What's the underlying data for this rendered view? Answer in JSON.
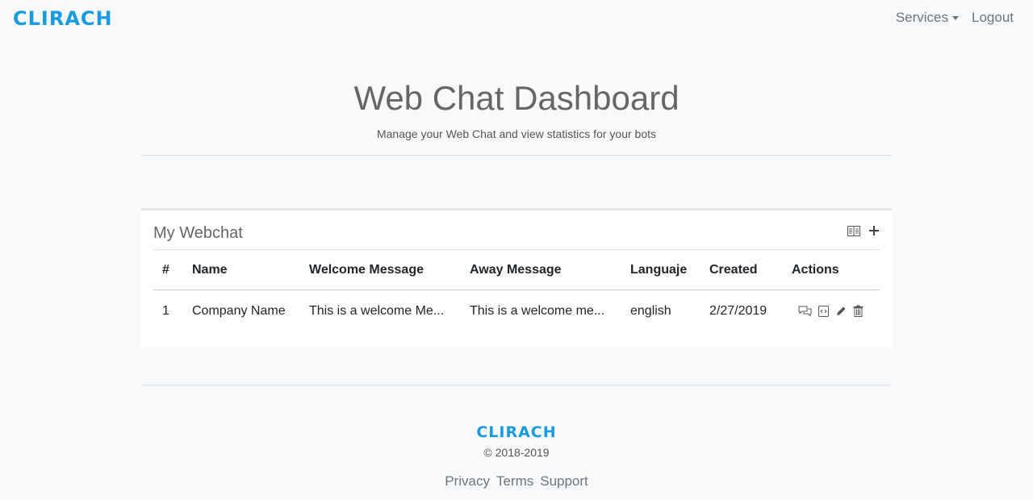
{
  "header": {
    "logo": "CLIRACH",
    "nav": {
      "services": "Services",
      "logout": "Logout"
    }
  },
  "hero": {
    "title": "Web Chat Dashboard",
    "subtitle": "Manage your Web Chat and view statistics for your bots"
  },
  "card": {
    "title": "My Webchat",
    "tools": [
      "list-view-icon",
      "add-icon"
    ],
    "columns": [
      "#",
      "Name",
      "Welcome Message",
      "Away Message",
      "Languaje",
      "Created",
      "Actions"
    ],
    "rows": [
      {
        "num": "1",
        "name": "Company Name",
        "welcome": "This is a welcome Me...",
        "away": "This is a welcome me...",
        "language": "english",
        "created": "2/27/2019",
        "actions": [
          "chat-icon",
          "code-icon",
          "edit-icon",
          "delete-icon"
        ]
      }
    ]
  },
  "footer": {
    "logo": "CLIRACH",
    "copyright": "© 2018-2019",
    "links": [
      "Privacy",
      "Terms",
      "Support"
    ]
  },
  "colors": {
    "brand": "#1a9be0",
    "background": "#f8f9fa",
    "muted": "#6c757d"
  }
}
